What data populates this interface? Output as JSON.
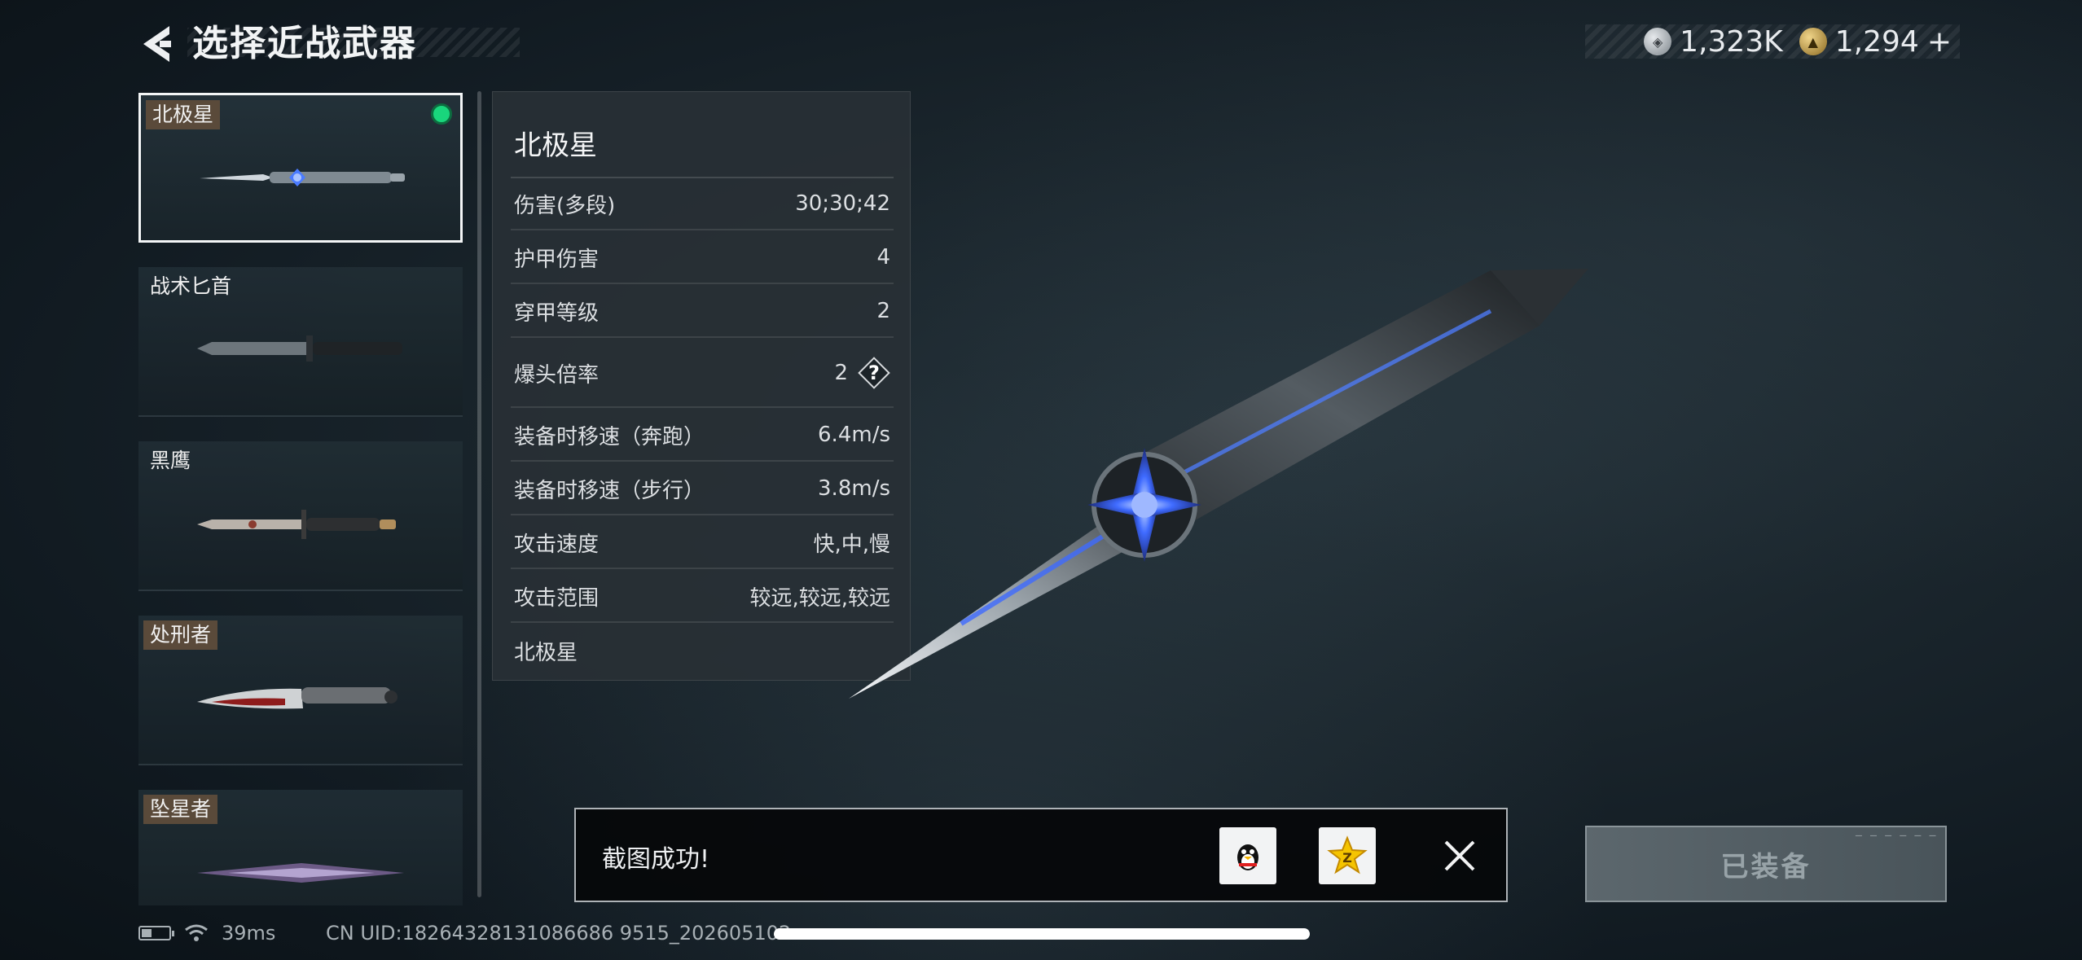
{
  "header": {
    "title": "选择近战武器",
    "currencies": [
      {
        "icon": "silver-coin-icon",
        "value": "1,323K"
      },
      {
        "icon": "gold-coin-icon",
        "value": "1,294",
        "plus": "+"
      }
    ]
  },
  "weapon_list": {
    "items": [
      {
        "name": "北极星",
        "tagged": true,
        "selected": true
      },
      {
        "name": "战术匕首",
        "tagged": false,
        "selected": false
      },
      {
        "name": "黑鹰",
        "tagged": false,
        "selected": false
      },
      {
        "name": "处刑者",
        "tagged": true,
        "selected": false
      },
      {
        "name": "坠星者",
        "tagged": true,
        "selected": false
      }
    ]
  },
  "stats": {
    "title": "北极星",
    "rows": [
      {
        "label": "伤害(多段)",
        "value": "30;30;42"
      },
      {
        "label": "护甲伤害",
        "value": "4"
      },
      {
        "label": "穿甲等级",
        "value": "2"
      },
      {
        "label": "爆头倍率",
        "value": "2",
        "help": "?"
      },
      {
        "label": "装备时移速（奔跑）",
        "value": "6.4m/s"
      },
      {
        "label": "装备时移速（步行）",
        "value": "3.8m/s"
      },
      {
        "label": "攻击速度",
        "value": "快,中,慢"
      },
      {
        "label": "攻击范围",
        "value": "较远,较远,较远"
      }
    ],
    "footer": "北极星"
  },
  "toast": {
    "message": "截图成功!"
  },
  "equip_button": {
    "label": "已装备"
  },
  "status_bar": {
    "ping": "39ms",
    "uid": "CN UID:18264328131086686 9515_202605102"
  },
  "colors": {
    "selected_indicator": "#19d67c",
    "name_tag_bg": "#5a4a3a",
    "knife_glow": "#3f6bff"
  }
}
